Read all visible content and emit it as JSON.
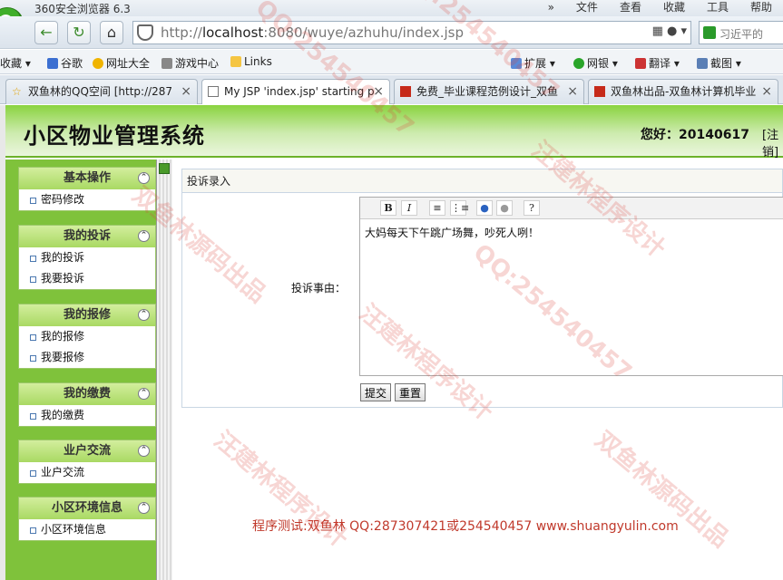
{
  "browser": {
    "app_title": "360安全浏览器 6.3",
    "menu": [
      "»",
      "文件",
      "查看",
      "收藏",
      "工具",
      "帮助"
    ],
    "url_prefix": "http://",
    "url_host": "localhost",
    "url_rest": ":8080/wuye/azhuhu/index.jsp",
    "search_placeholder": "习近平的",
    "bookmarks": [
      "收藏",
      "谷歌",
      "网址大全",
      "游戏中心",
      "Links",
      "扩展",
      "网银",
      "翻译",
      "截图"
    ],
    "tabs": [
      {
        "label": "双鱼林的QQ空间 [http://287",
        "active": false
      },
      {
        "label": "My JSP 'index.jsp' starting p",
        "active": true
      },
      {
        "label": "免费_毕业课程范例设计_双鱼",
        "active": false
      },
      {
        "label": "双鱼林出品-双鱼林计算机毕业",
        "active": false
      }
    ]
  },
  "header": {
    "system_title": "小区物业管理系统",
    "greeting": "您好：20140617",
    "logout": "[注销]"
  },
  "sidebar": {
    "groups": [
      {
        "title": "基本操作",
        "items": [
          "密码修改"
        ]
      },
      {
        "title": "我的投诉",
        "items": [
          "我的投诉",
          "我要投诉"
        ]
      },
      {
        "title": "我的报修",
        "items": [
          "我的报修",
          "我要报修"
        ]
      },
      {
        "title": "我的缴费",
        "items": [
          "我的缴费"
        ]
      },
      {
        "title": "业户交流",
        "items": [
          "业户交流"
        ]
      },
      {
        "title": "小区环境信息",
        "items": [
          "小区环境信息"
        ]
      }
    ]
  },
  "form": {
    "title": "投诉录入",
    "reason_label": "投诉事由：",
    "editor_toolbar": [
      "B",
      "I",
      "ol",
      "ul",
      "link",
      "unlink",
      "?"
    ],
    "content": "大妈每天下午跳广场舞，吵死人咧！",
    "submit_label": "提交",
    "reset_label": "重置"
  },
  "footer": {
    "credit": "程序测试:双鱼林 QQ:287307421或254540457 www.shuangyulin.com"
  },
  "watermark": {
    "text_a": "汪建林程序设计",
    "text_b": "QQ:254540457",
    "text_c": "双鱼林源码出品"
  }
}
